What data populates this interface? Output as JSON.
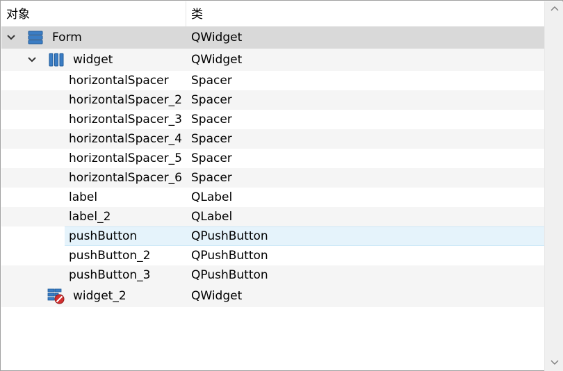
{
  "header": {
    "object_label": "对象",
    "class_label": "类"
  },
  "tree": [
    {
      "name": "Form",
      "class": "QWidget",
      "icon": "form-layout-icon",
      "expanded": true
    },
    {
      "name": "widget",
      "class": "QWidget",
      "icon": "horizontal-layout-icon",
      "expanded": true
    },
    {
      "name": "horizontalSpacer",
      "class": "Spacer"
    },
    {
      "name": "horizontalSpacer_2",
      "class": "Spacer"
    },
    {
      "name": "horizontalSpacer_3",
      "class": "Spacer"
    },
    {
      "name": "horizontalSpacer_4",
      "class": "Spacer"
    },
    {
      "name": "horizontalSpacer_5",
      "class": "Spacer"
    },
    {
      "name": "horizontalSpacer_6",
      "class": "Spacer"
    },
    {
      "name": "label",
      "class": "QLabel"
    },
    {
      "name": "label_2",
      "class": "QLabel"
    },
    {
      "name": "pushButton",
      "class": "QPushButton",
      "hovered": true
    },
    {
      "name": "pushButton_2",
      "class": "QPushButton"
    },
    {
      "name": "pushButton_3",
      "class": "QPushButton"
    },
    {
      "name": "widget_2",
      "class": "QWidget",
      "icon": "broken-layout-icon"
    }
  ],
  "colors": {
    "selected_row": "#d9d9d9",
    "hover_row": "#e5f3fb",
    "icon_blue": "#2f6fb7",
    "icon_red": "#d32f2f"
  }
}
